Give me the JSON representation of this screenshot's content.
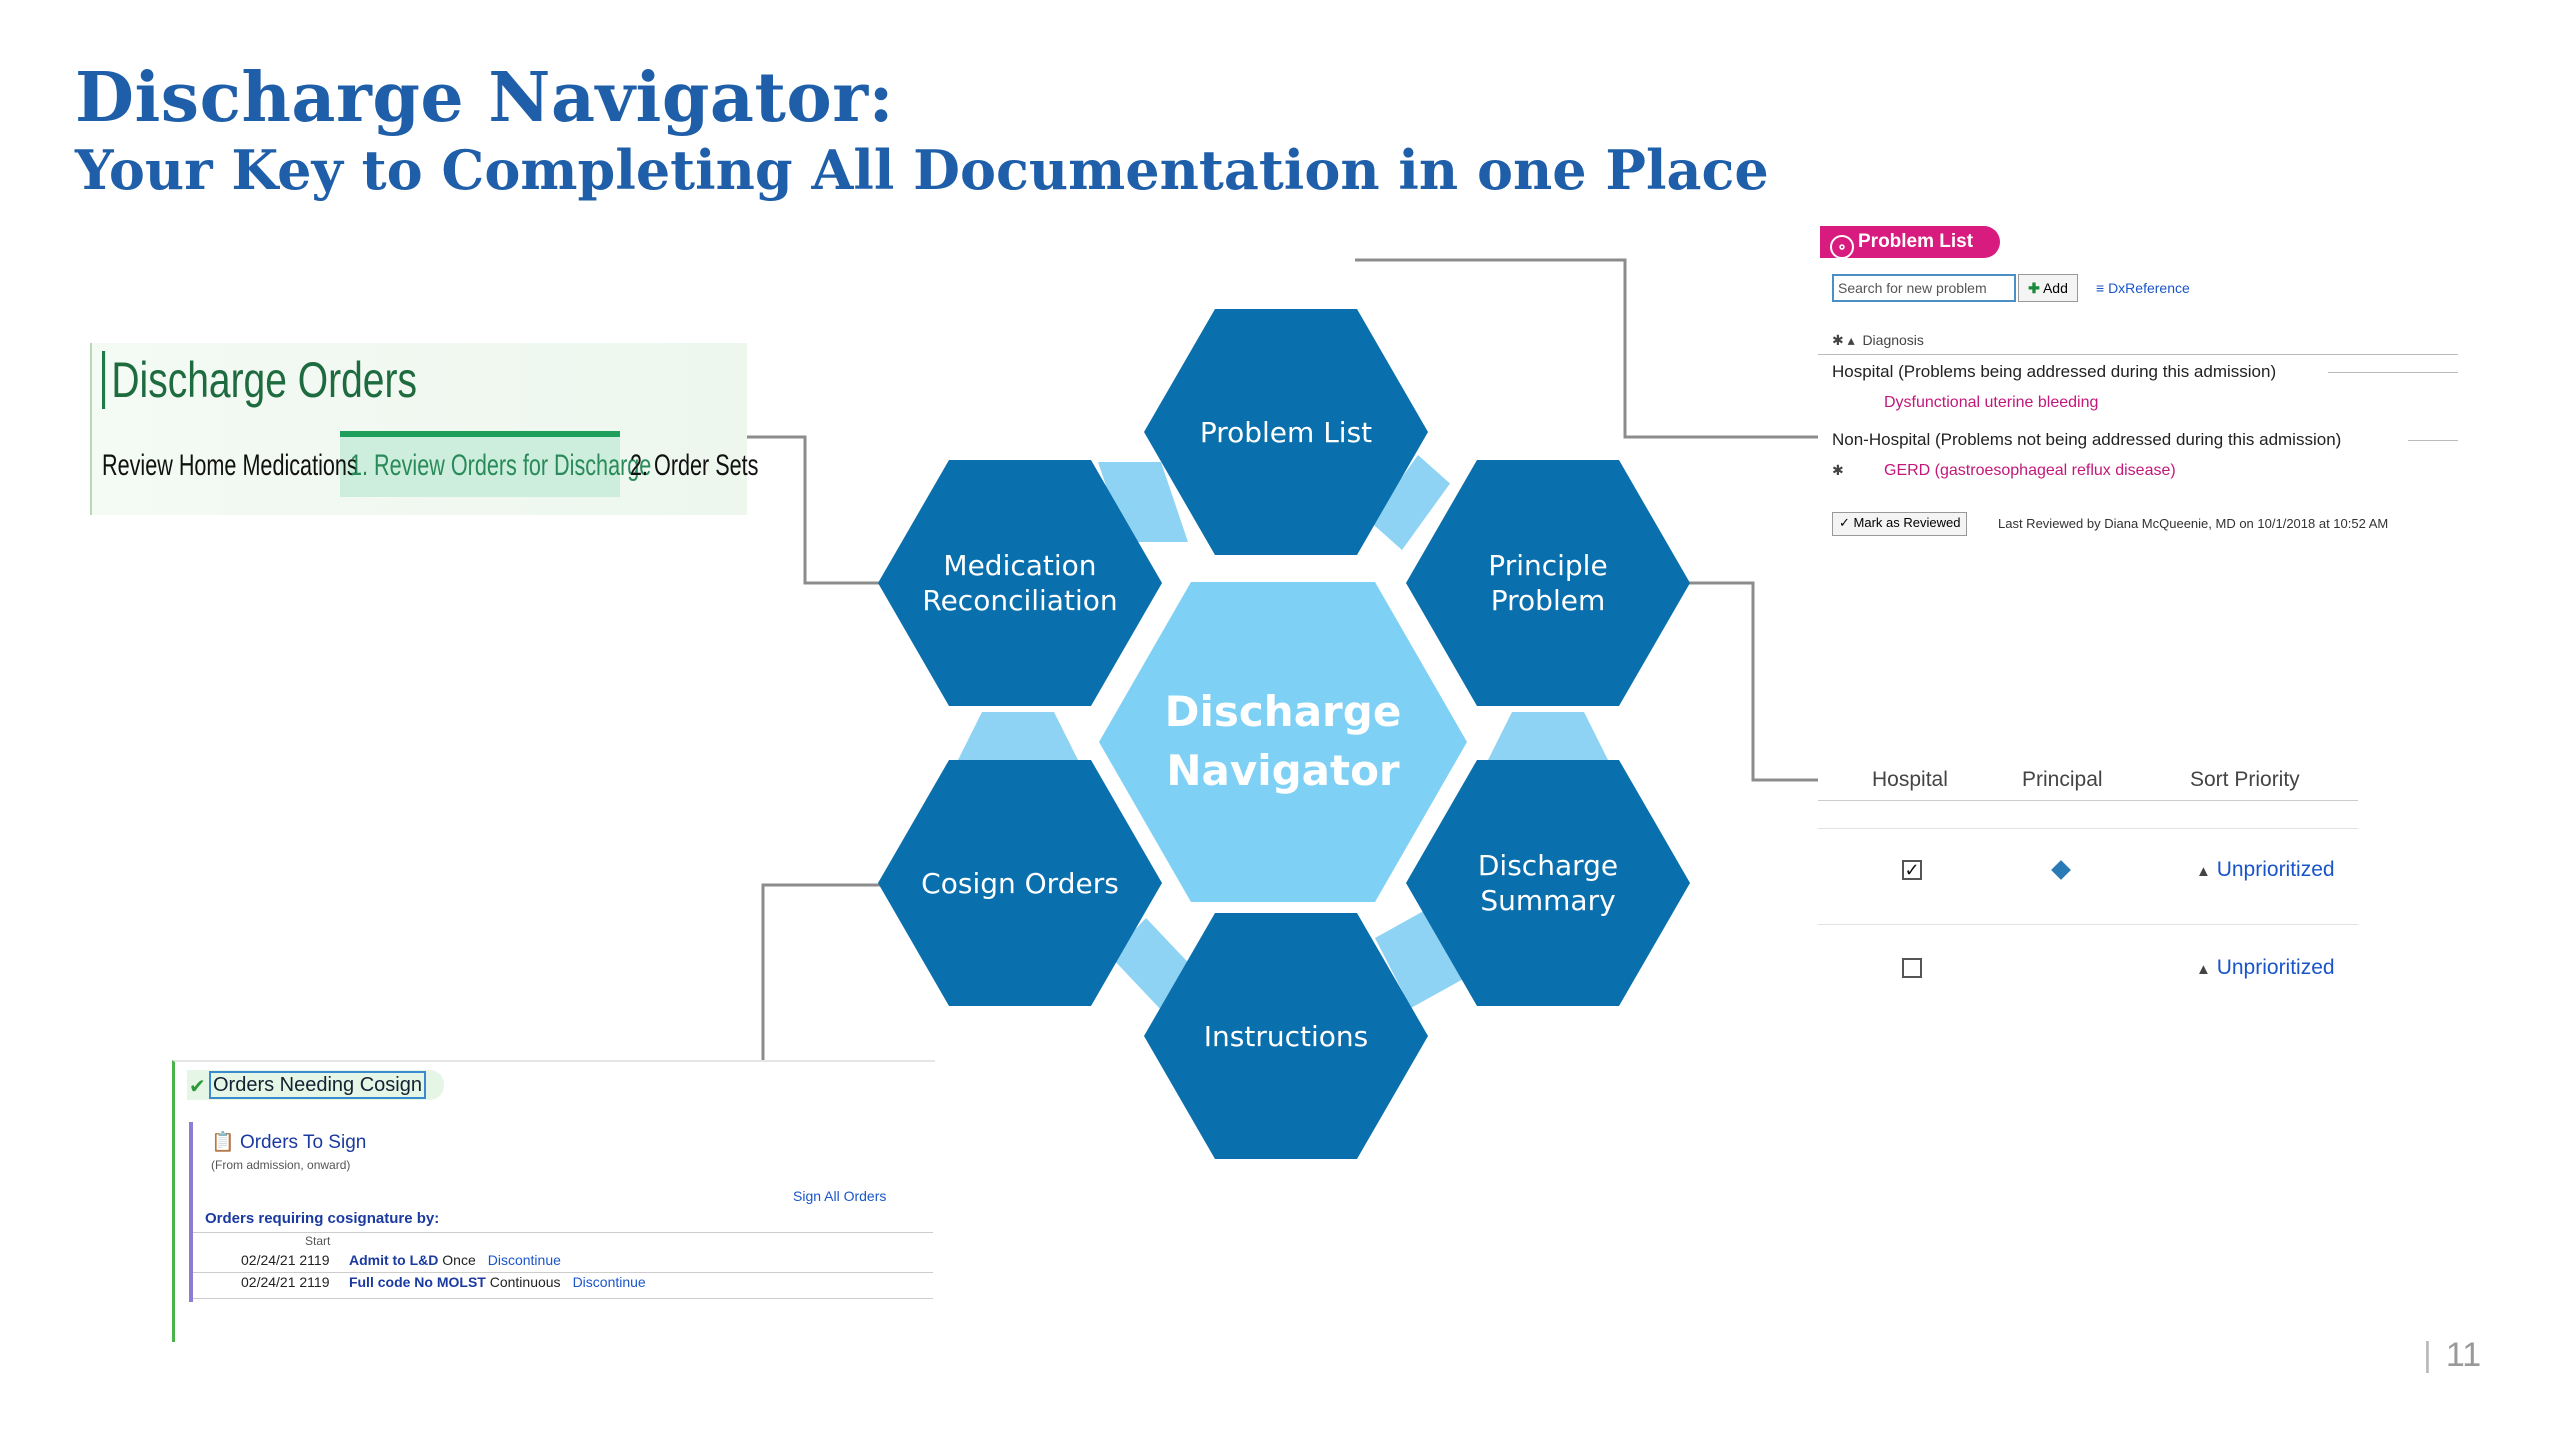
{
  "slide": {
    "title": "Discharge Navigator:",
    "subtitle": "Your Key to Completing All Documentation in one Place",
    "page_number": "11",
    "page_separator": "|"
  },
  "colors": {
    "title": "#1f5fa9",
    "hex_dark": "#0a6fad",
    "hex_center": "#7fd0f5",
    "connector": "#888888"
  },
  "hexagons": {
    "center": {
      "line1": "Discharge",
      "line2": "Navigator"
    },
    "problem_list": "Problem List",
    "principle_problem": {
      "line1": "Principle",
      "line2": "Problem"
    },
    "discharge_summary": {
      "line1": "Discharge",
      "line2": "Summary"
    },
    "instructions": "Instructions",
    "cosign_orders": "Cosign Orders",
    "medication_reconciliation": {
      "line1": "Medication",
      "line2": "Reconciliation"
    }
  },
  "discharge_orders": {
    "title": "Discharge Orders",
    "tabs": [
      "Review Home Medications",
      "1. Review Orders for Discharge",
      "2. Order Sets"
    ],
    "active_tab": 1
  },
  "problem_list_panel": {
    "tab_label": "Problem List",
    "search_placeholder": "Search for new problem",
    "add_label": "Add",
    "add_icon": "plus-icon",
    "dx_reference": "DxReference",
    "diagnosis_header": "Diagnosis",
    "hospital_section": "Hospital (Problems being addressed during this admission)",
    "hospital_item": "Dysfunctional uterine bleeding",
    "non_hospital_section": "Non-Hospital (Problems not being addressed during this admission)",
    "non_hospital_item": "GERD (gastroesophageal reflux disease)",
    "mark_reviewed": "Mark as Reviewed",
    "last_reviewed": "Last Reviewed by Diana McQueenie, MD on 10/1/2018 at 10:52 AM"
  },
  "priority_table": {
    "headers": [
      "Hospital",
      "Principal",
      "Sort Priority"
    ],
    "rows": [
      {
        "hospital_checked": true,
        "principal": true,
        "sort_priority": "Unprioritized"
      },
      {
        "hospital_checked": false,
        "principal": false,
        "sort_priority": "Unprioritized"
      }
    ]
  },
  "cosign_panel": {
    "tab_label": "Orders Needing Cosign",
    "section_title": "Orders To Sign",
    "section_sub": "(From admission, onward)",
    "sign_all": "Sign All Orders",
    "requiring": "Orders requiring cosignature by:",
    "start_header": "Start",
    "rows": [
      {
        "start": "02/24/21 2119",
        "order": "Admit to L&D",
        "freq": "Once",
        "action": "Discontinue"
      },
      {
        "start": "02/24/21 2119",
        "order": "Full code No MOLST",
        "freq": "Continuous",
        "action": "Discontinue"
      }
    ]
  }
}
